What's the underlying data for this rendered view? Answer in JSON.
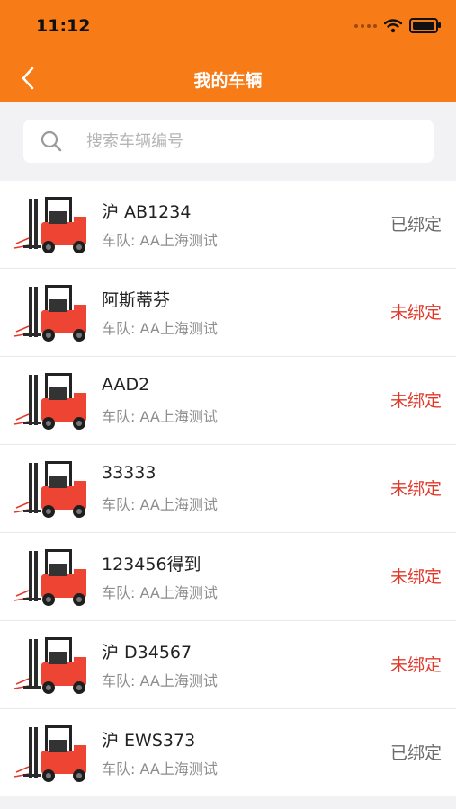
{
  "status_bar": {
    "time": "11:12"
  },
  "nav": {
    "title": "我的车辆"
  },
  "search": {
    "placeholder": "搜索车辆编号"
  },
  "vehicles": [
    {
      "plate": "沪 AB1234",
      "fleet": "车队: AA上海测试",
      "status": "已绑定",
      "status_type": "bound"
    },
    {
      "plate": "阿斯蒂芬",
      "fleet": "车队: AA上海测试",
      "status": "未绑定",
      "status_type": "unbound"
    },
    {
      "plate": "AAD2",
      "fleet": "车队: AA上海测试",
      "status": "未绑定",
      "status_type": "unbound"
    },
    {
      "plate": "33333",
      "fleet": "车队: AA上海测试",
      "status": "未绑定",
      "status_type": "unbound"
    },
    {
      "plate": "123456得到",
      "fleet": "车队: AA上海测试",
      "status": "未绑定",
      "status_type": "unbound"
    },
    {
      "plate": "沪 D34567",
      "fleet": "车队: AA上海测试",
      "status": "未绑定",
      "status_type": "unbound"
    },
    {
      "plate": "沪 EWS373",
      "fleet": "车队: AA上海测试",
      "status": "已绑定",
      "status_type": "bound"
    }
  ],
  "colors": {
    "accent": "#f77b16",
    "unbound": "#e2382a",
    "bound": "#6b6b6b"
  },
  "icons": {
    "back": "chevron-left-icon",
    "search": "search-icon",
    "vehicle": "forklift-icon",
    "wifi": "wifi-icon",
    "battery": "battery-icon"
  }
}
